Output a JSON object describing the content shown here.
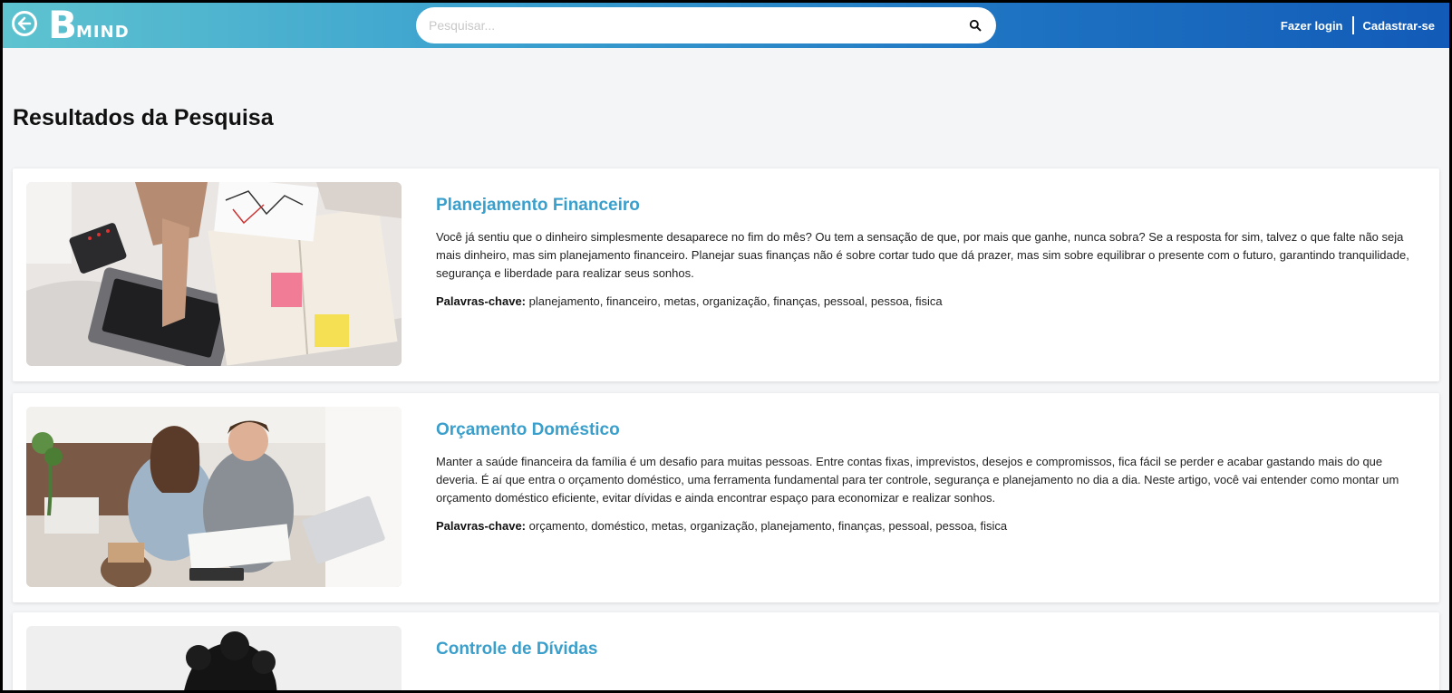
{
  "header": {
    "back_icon": "back-arrow-circle-icon",
    "logo_letter": "B",
    "logo_text": "MIND",
    "search_placeholder": "Pesquisar...",
    "search_value": "",
    "search_icon": "search-icon",
    "login_label": "Fazer login",
    "signup_label": "Cadastrar-se"
  },
  "main": {
    "title": "Resultados da Pesquisa",
    "keywords_label": "Palavras-chave:",
    "results": [
      {
        "title": "Planejamento Financeiro",
        "text": "Você já sentiu que o dinheiro simplesmente desaparece no fim do mês? Ou tem a sensação de que, por mais que ganhe, nunca sobra? Se a resposta for sim, talvez o que falte não seja mais dinheiro, mas sim planejamento financeiro. Planejar suas finanças não é sobre cortar tudo que dá prazer, mas sim sobre equilibrar o presente com o futuro, garantindo tranquilidade, segurança e liberdade para realizar seus sonhos.",
        "keywords": "planejamento, financeiro, metas, organização, finanças, pessoal, pessoa, fisica"
      },
      {
        "title": "Orçamento Doméstico",
        "text": "Manter a saúde financeira da família é um desafio para muitas pessoas. Entre contas fixas, imprevistos, desejos e compromissos, fica fácil se perder e acabar gastando mais do que deveria. É aí que entra o orçamento doméstico, uma ferramenta fundamental para ter controle, segurança e planejamento no dia a dia. Neste artigo, você vai entender como montar um orçamento doméstico eficiente, evitar dívidas e ainda encontrar espaço para economizar e realizar sonhos.",
        "keywords": "orçamento, doméstico, metas, organização, planejamento, finanças, pessoal, pessoa, fisica"
      },
      {
        "title": "Controle de Dívidas"
      }
    ]
  },
  "colors": {
    "header_gradient_start": "#5ec3cf",
    "header_gradient_end": "#125bb8",
    "title_blue": "#3a9fcb",
    "page_bg": "#f4f5f7"
  }
}
